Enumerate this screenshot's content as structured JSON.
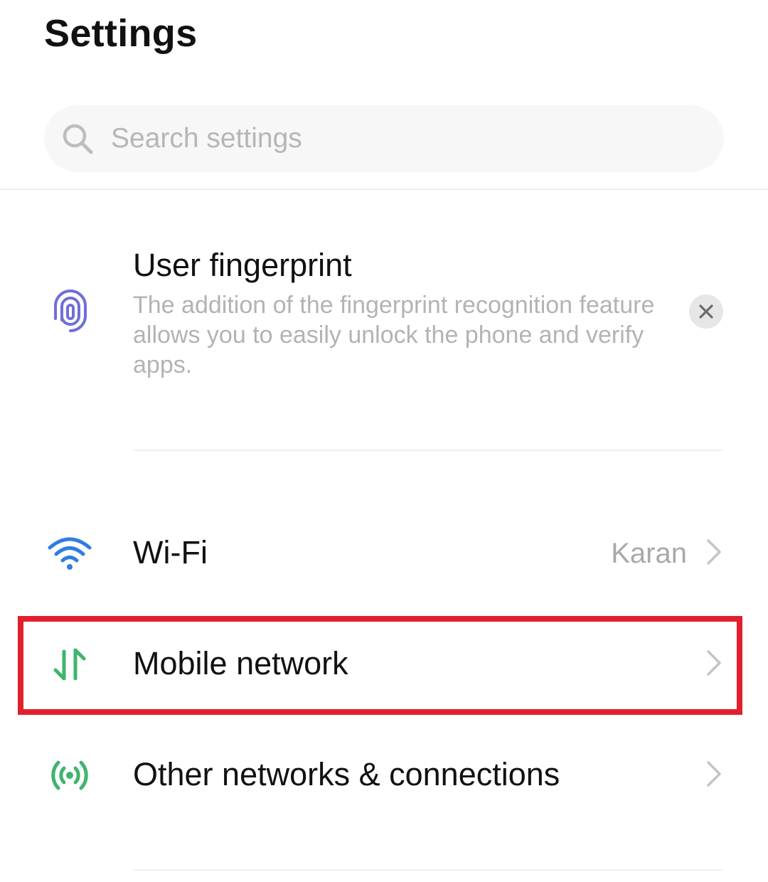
{
  "header": {
    "title": "Settings"
  },
  "search": {
    "placeholder": "Search settings",
    "icon": "search-icon"
  },
  "suggestion": {
    "icon": "fingerprint-icon",
    "title": "User fingerprint",
    "description": "The addition of the fingerprint recognition feature allows you to easily unlock the phone and verify apps.",
    "dismiss_icon": "close-icon"
  },
  "settings_items": [
    {
      "id": "wifi",
      "icon": "wifi-icon",
      "label": "Wi-Fi",
      "value": "Karan"
    },
    {
      "id": "mobile-network",
      "icon": "mobile-data-icon",
      "label": "Mobile network",
      "value": ""
    },
    {
      "id": "other-networks",
      "icon": "connections-icon",
      "label": "Other networks & connections",
      "value": ""
    }
  ],
  "colors": {
    "highlight": "#e0202c",
    "wifi_icon": "#2f7de1",
    "network_icon": "#3fb56e",
    "fingerprint_icon": "#6f6fd6"
  }
}
